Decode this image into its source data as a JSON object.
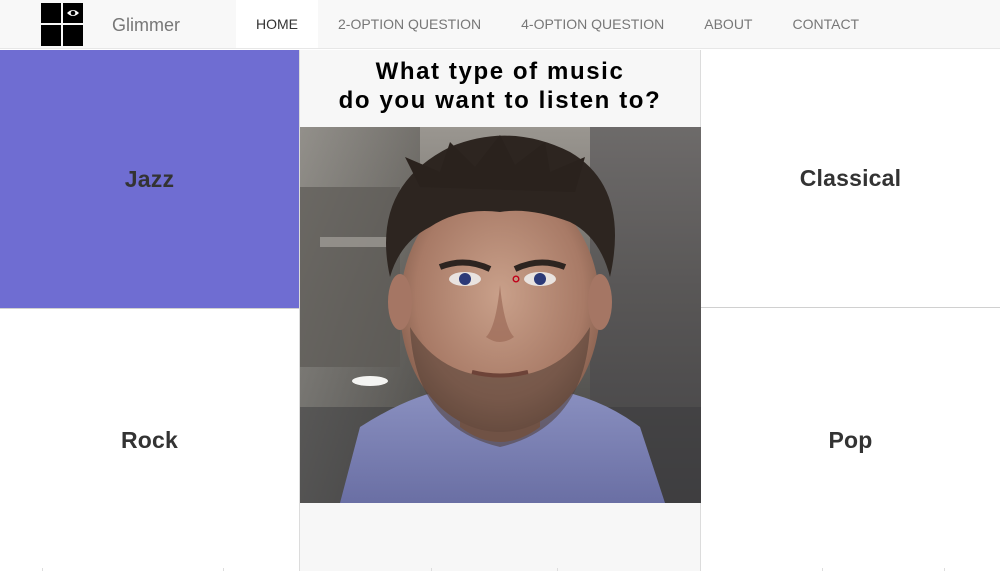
{
  "brand": {
    "name": "Glimmer"
  },
  "nav": {
    "items": [
      {
        "label": "HOME",
        "active": true
      },
      {
        "label": "2-OPTION QUESTION",
        "active": false
      },
      {
        "label": "4-OPTION QUESTION",
        "active": false
      },
      {
        "label": "ABOUT",
        "active": false
      },
      {
        "label": "CONTACT",
        "active": false
      }
    ]
  },
  "question": {
    "line1": "What type of music",
    "line2": "do you want to listen to?"
  },
  "options": {
    "top_left": "Jazz",
    "top_right": "Classical",
    "bottom_left": "Rock",
    "bottom_right": "Pop"
  },
  "colors": {
    "selected": "#6f6dd2",
    "nav_bg": "#f8f8f8",
    "text": "#333333"
  },
  "icons": {
    "logo": "eye-grid-icon",
    "gaze_marker": "gaze-point-icon"
  }
}
